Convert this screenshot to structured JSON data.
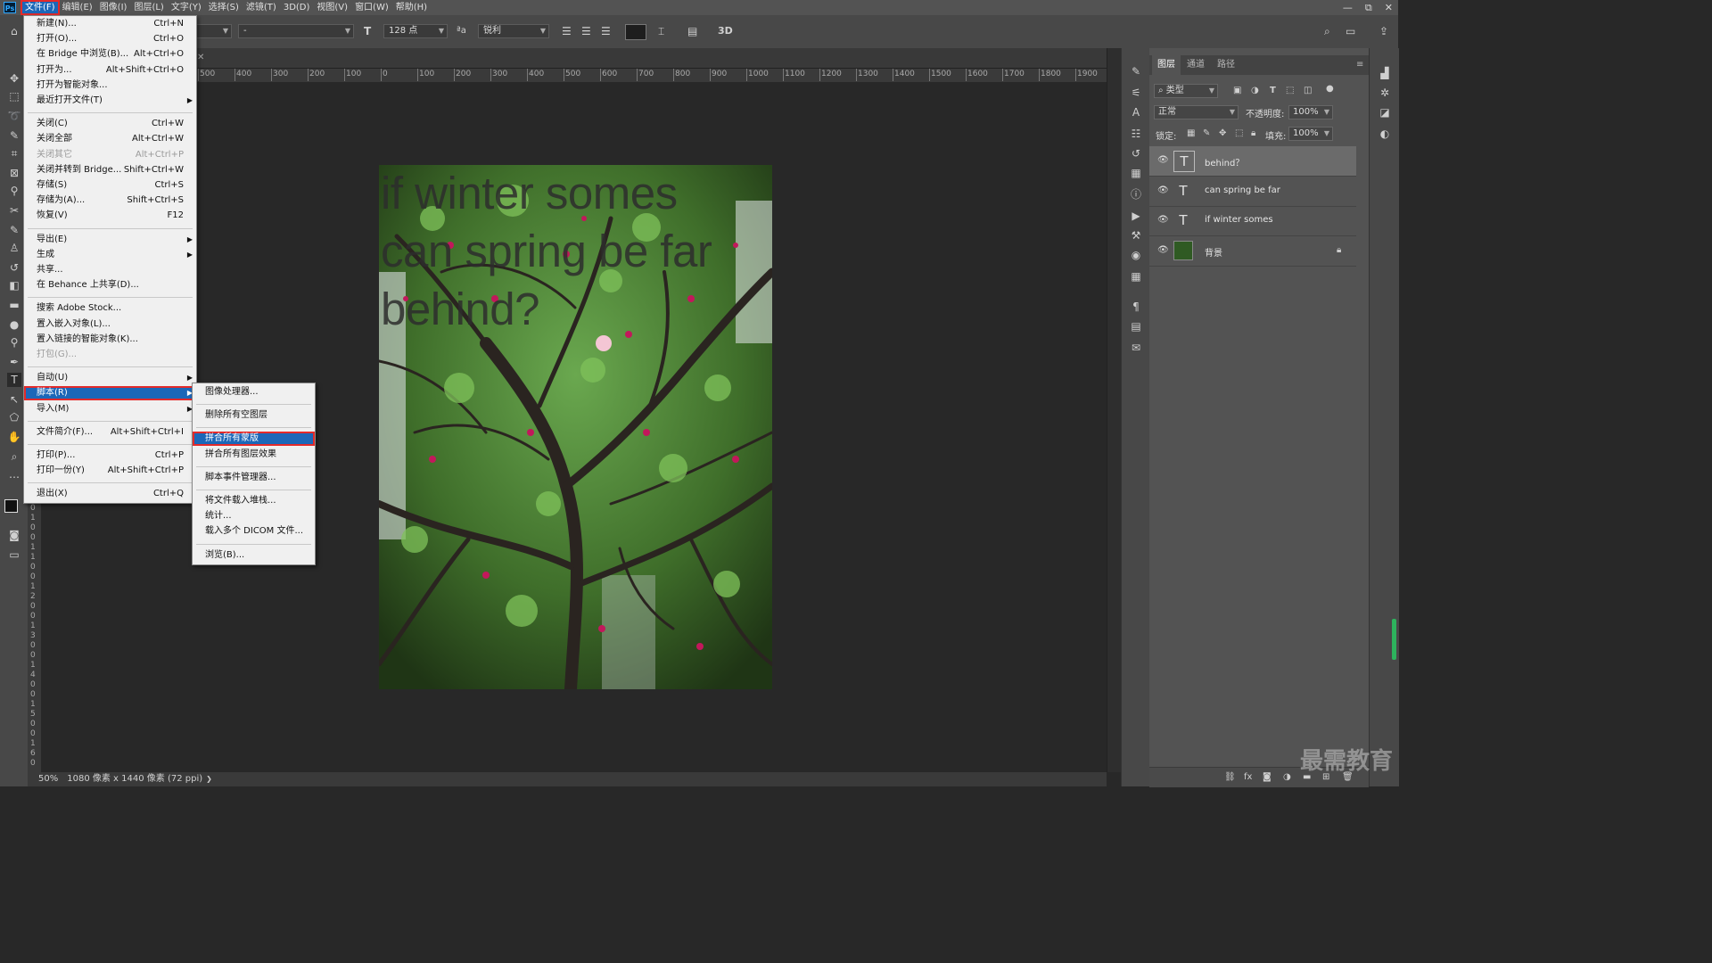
{
  "menubar": {
    "app_logo": "Ps",
    "items": [
      "文件(F)",
      "编辑(E)",
      "图像(I)",
      "图层(L)",
      "文字(Y)",
      "选择(S)",
      "滤镜(T)",
      "3D(D)",
      "视图(V)",
      "窗口(W)",
      "帮助(H)"
    ],
    "active_index": 0
  },
  "window_controls": {
    "minimize": "—",
    "restore": "⧉",
    "close": "✕"
  },
  "options_bar": {
    "font_style": "-",
    "font_size": "128 点",
    "aa_label": "ªa",
    "antialias": "锐利",
    "btn_3d": "3D",
    "text_color": "#1e1e1e"
  },
  "ruler": {
    "h_labels": [
      "500",
      "400",
      "300",
      "200",
      "100",
      "0",
      "100",
      "200",
      "300",
      "400",
      "500",
      "600",
      "700",
      "800",
      "900",
      "1000",
      "1100",
      "1200",
      "1300",
      "1400",
      "1500",
      "1600",
      "1700",
      "1800",
      "1900"
    ],
    "v_labels": [
      "0",
      "1",
      "0",
      "0",
      "1",
      "1",
      "0",
      "0",
      "1",
      "2",
      "0",
      "0",
      "1",
      "3",
      "0",
      "0",
      "1",
      "4",
      "0",
      "0",
      "1",
      "5",
      "0",
      "0",
      "1",
      "6",
      "0"
    ]
  },
  "canvas_text": [
    "if winter somes",
    "can spring be far",
    "behind?"
  ],
  "status": {
    "zoom": "50%",
    "doc_info": "1080 像素 x 1440 像素 (72 ppi)",
    "arrow": "❯"
  },
  "file_menu": {
    "items": [
      {
        "label": "新建(N)...",
        "shortcut": "Ctrl+N"
      },
      {
        "label": "打开(O)...",
        "shortcut": "Ctrl+O"
      },
      {
        "label": "在 Bridge 中浏览(B)...",
        "shortcut": "Alt+Ctrl+O"
      },
      {
        "label": "打开为...",
        "shortcut": "Alt+Shift+Ctrl+O"
      },
      {
        "label": "打开为智能对象..."
      },
      {
        "label": "最近打开文件(T)",
        "submenu": true
      },
      {
        "sep": true
      },
      {
        "label": "关闭(C)",
        "shortcut": "Ctrl+W"
      },
      {
        "label": "关闭全部",
        "shortcut": "Alt+Ctrl+W"
      },
      {
        "label": "关闭其它",
        "shortcut": "Alt+Ctrl+P",
        "disabled": true
      },
      {
        "label": "关闭并转到 Bridge...",
        "shortcut": "Shift+Ctrl+W"
      },
      {
        "label": "存储(S)",
        "shortcut": "Ctrl+S"
      },
      {
        "label": "存储为(A)...",
        "shortcut": "Shift+Ctrl+S"
      },
      {
        "label": "恢复(V)",
        "shortcut": "F12"
      },
      {
        "sep": true
      },
      {
        "label": "导出(E)",
        "submenu": true
      },
      {
        "label": "生成",
        "submenu": true
      },
      {
        "label": "共享..."
      },
      {
        "label": "在 Behance 上共享(D)..."
      },
      {
        "sep": true
      },
      {
        "label": "搜索 Adobe Stock..."
      },
      {
        "label": "置入嵌入对象(L)..."
      },
      {
        "label": "置入链接的智能对象(K)..."
      },
      {
        "label": "打包(G)...",
        "disabled": true
      },
      {
        "sep": true
      },
      {
        "label": "自动(U)",
        "submenu": true
      },
      {
        "label": "脚本(R)",
        "submenu": true,
        "highlight": true
      },
      {
        "label": "导入(M)",
        "submenu": true
      },
      {
        "sep": true
      },
      {
        "label": "文件简介(F)...",
        "shortcut": "Alt+Shift+Ctrl+I"
      },
      {
        "sep": true
      },
      {
        "label": "打印(P)...",
        "shortcut": "Ctrl+P"
      },
      {
        "label": "打印一份(Y)",
        "shortcut": "Alt+Shift+Ctrl+P"
      },
      {
        "sep": true
      },
      {
        "label": "退出(X)",
        "shortcut": "Ctrl+Q"
      }
    ]
  },
  "script_submenu": {
    "items": [
      {
        "label": "图像处理器..."
      },
      {
        "sep": true
      },
      {
        "label": "删除所有空图层"
      },
      {
        "sep": true
      },
      {
        "label": "拼合所有蒙版",
        "highlight": true
      },
      {
        "label": "拼合所有图层效果"
      },
      {
        "sep": true
      },
      {
        "label": "脚本事件管理器..."
      },
      {
        "sep": true
      },
      {
        "label": "将文件载入堆栈..."
      },
      {
        "label": "统计..."
      },
      {
        "label": "载入多个 DICOM 文件..."
      },
      {
        "sep": true
      },
      {
        "label": "浏览(B)..."
      }
    ]
  },
  "layers_panel": {
    "tabs": [
      "图层",
      "通道",
      "路径"
    ],
    "filter_kind": "类型",
    "blend_mode": "正常",
    "opacity_label": "不透明度:",
    "opacity_value": "100%",
    "lock_label": "锁定:",
    "fill_label": "填充:",
    "fill_value": "100%",
    "layers": [
      {
        "name": "behind？",
        "type": "text",
        "selected": true
      },
      {
        "name": "can spring be far",
        "type": "text"
      },
      {
        "name": "if winter somes",
        "type": "text"
      },
      {
        "name": "背景",
        "type": "image",
        "locked": true
      }
    ],
    "text_glyph": "T"
  },
  "watermark": "最需教育"
}
